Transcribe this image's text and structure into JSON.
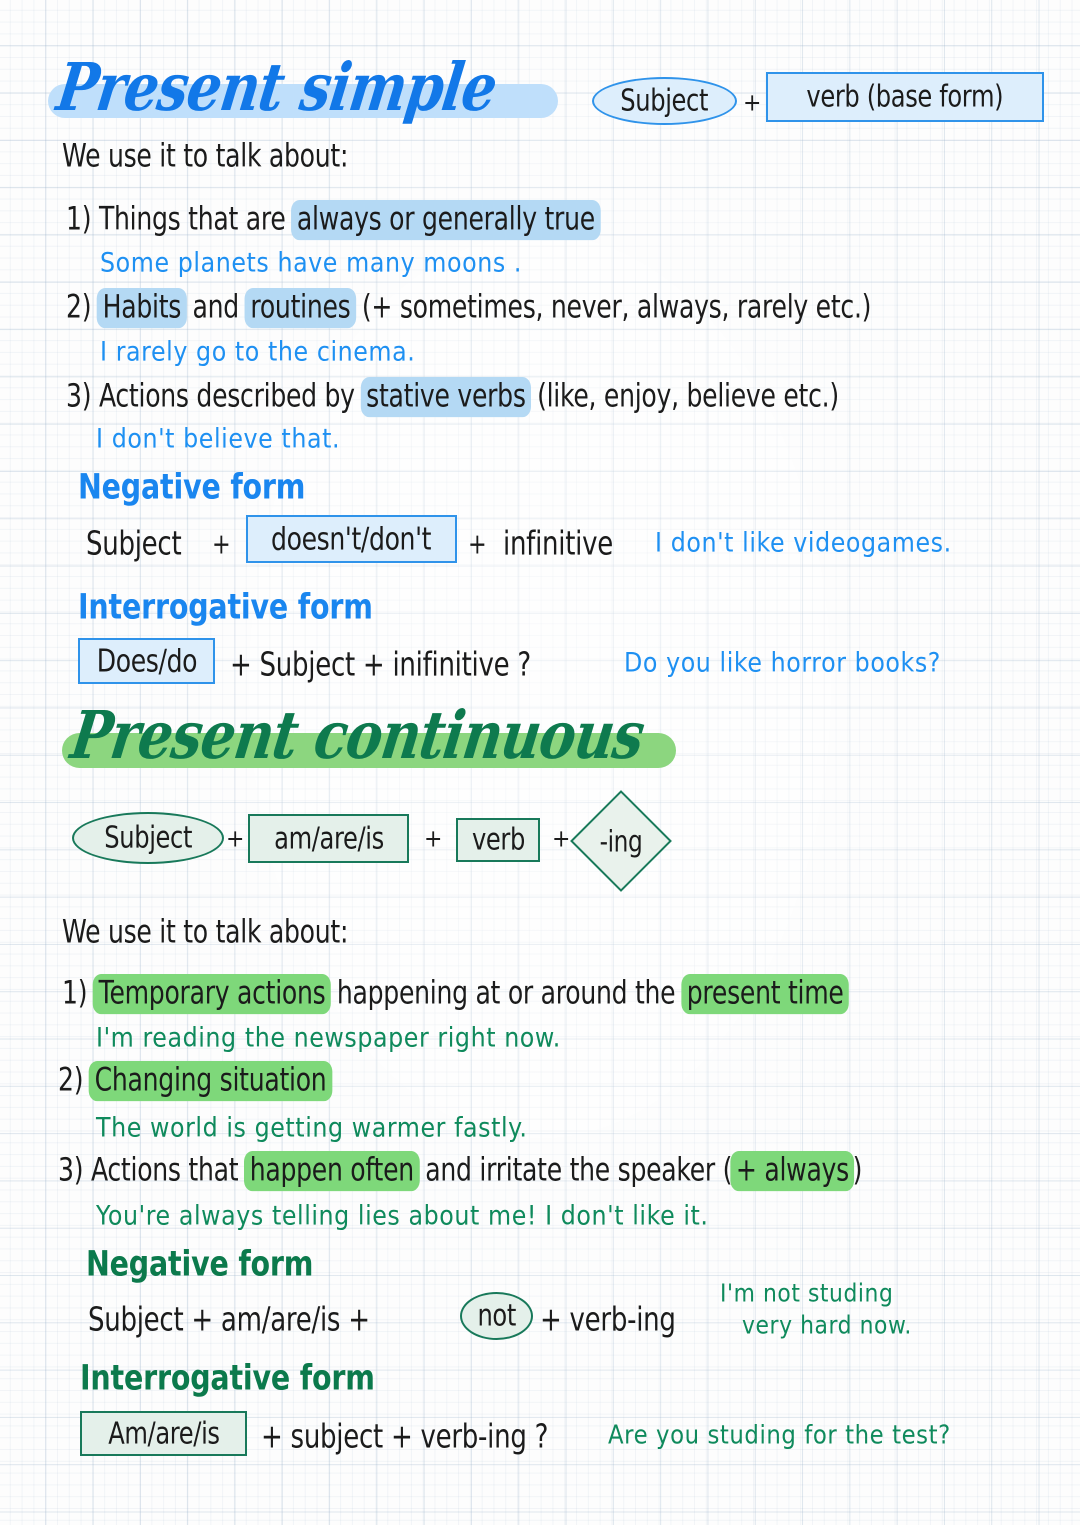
{
  "page": {
    "background": "grid-paper",
    "colors": {
      "blue_ink": "#1e90f2",
      "blue_title": "#1278e8",
      "blue_highlight": "#b4d9f4",
      "green_ink": "#0f8a5c",
      "green_title": "#0e7a4e",
      "green_highlight": "#7ed87a",
      "print_ink": "#1b1b1b"
    }
  },
  "present_simple": {
    "title": "Present simple",
    "formula": {
      "subject": "Subject",
      "plus": "+",
      "verb": "verb (base form)"
    },
    "intro": "We use it to talk about:",
    "uses": [
      {
        "number": "1)",
        "text_before": "Things that are ",
        "highlight": "always or generally true",
        "text_after": "",
        "example": "Some planets have many moons ."
      },
      {
        "number": "2)",
        "highlight": "Habits",
        "mid": " and ",
        "highlight2": "routines",
        "text_after": " (+ sometimes, never, always, rarely etc.)",
        "example": "I rarely go to the cinema."
      },
      {
        "number": "3)",
        "text_before": "Actions described by ",
        "highlight": "stative verbs",
        "text_after": " (like, enjoy, believe etc.)",
        "example": "I don't believe that."
      }
    ],
    "negative": {
      "heading": "Negative form",
      "part1": "Subject",
      "plus1": "+",
      "box": "doesn't/don't",
      "plus2": "+",
      "part2": "infinitive",
      "example": "I don't like videogames."
    },
    "interrogative": {
      "heading": "Interrogative form",
      "box": "Does/do",
      "rest": "+  Subject  +  inifinitive ?",
      "example": "Do you like horror books?"
    }
  },
  "present_continuous": {
    "title": "Present continuous",
    "formula": {
      "subject": "Subject",
      "plus1": "+",
      "aux": "am/are/is",
      "plus2": "+",
      "verb": "verb",
      "plus3": "+",
      "ing": "-ing"
    },
    "intro": "We use it to talk about:",
    "uses": [
      {
        "number": "1)",
        "highlight": "Temporary actions",
        "mid": " happening at or around the ",
        "highlight2": "present time",
        "example": "I'm reading the newspaper right now."
      },
      {
        "number": "2)",
        "highlight": "Changing situation",
        "example": "The world is getting warmer fastly."
      },
      {
        "number": "3)",
        "text_before": "Actions that ",
        "highlight": "happen often",
        "mid": " and irritate the speaker (",
        "highlight2": "+ always",
        "text_after": ")",
        "example": "You're always telling lies about me! I don't like it."
      }
    ],
    "negative": {
      "heading": "Negative form",
      "part1": "Subject  +  am/are/is  +",
      "oval": "not",
      "part2": "+  verb-ing",
      "example_line1": "I'm not studing",
      "example_line2": "very hard now."
    },
    "interrogative": {
      "heading": "Interrogative form",
      "box": "Am/are/is",
      "rest": "+ subject + verb-ing ?",
      "example": "Are you studing for the test?"
    }
  }
}
